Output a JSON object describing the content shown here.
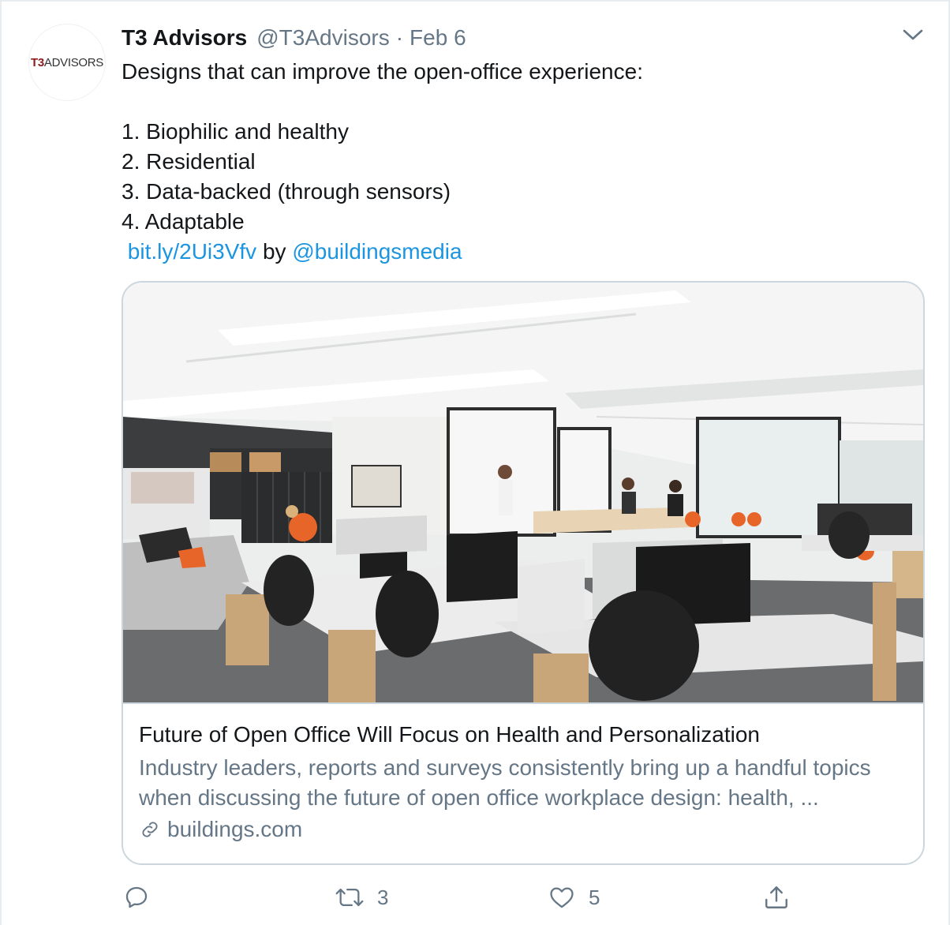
{
  "tweet": {
    "avatar_logo_bold": "T3",
    "avatar_logo_rest": "ADVISORS",
    "author_name": "T3 Advisors",
    "author_handle": "@T3Advisors",
    "separator": "·",
    "date": "Feb 6",
    "text_lines": [
      "Designs that can improve the open-office experience:",
      "1. Biophilic and healthy",
      "2. Residential",
      "3. Data-backed (through sensors)",
      "4. Adaptable"
    ],
    "short_link": "bit.ly/2Ui3Vfv",
    "by_text": "by",
    "mention": "@buildingsmedia",
    "link_color": "#1b95e0"
  },
  "card": {
    "title": "Future of Open Office Will Focus on Health and Personalization",
    "description_lines": [
      "Industry leaders, reports and surveys consistently bring up a handful topics",
      "when discussing the future of open office workplace design: health, ..."
    ],
    "domain": "buildings.com"
  },
  "actions": {
    "reply_icon": "reply-icon",
    "retweet_icon": "retweet-icon",
    "retweet_count": "3",
    "like_icon": "heart-icon",
    "like_count": "5",
    "share_icon": "share-icon"
  }
}
